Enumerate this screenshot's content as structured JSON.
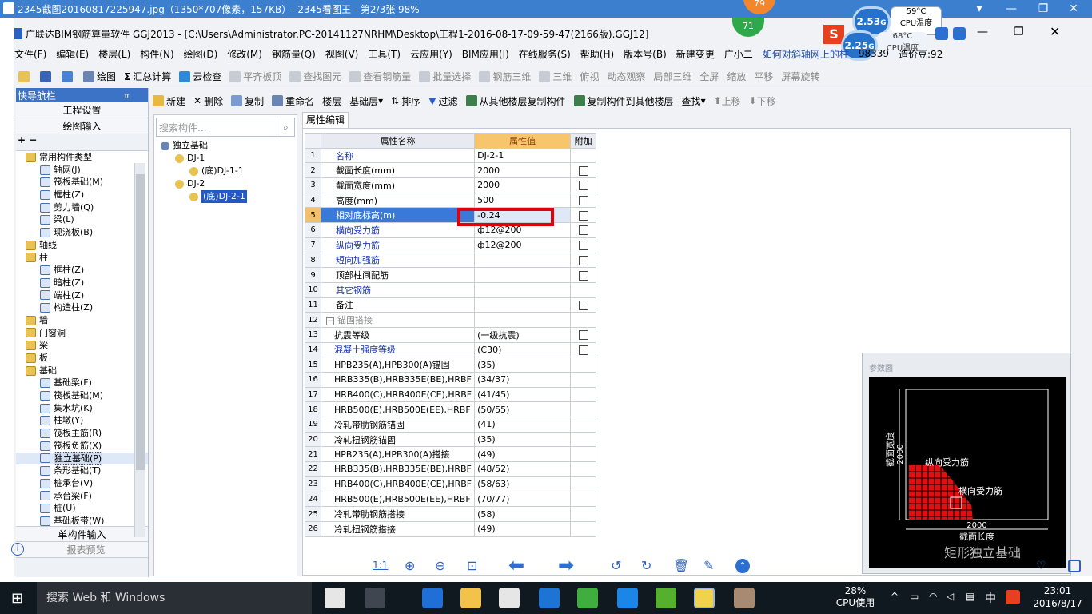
{
  "viewer": {
    "title": "2345截图20160817225947.jpg（1350*707像素，157KB）- 2345看图王 - 第2/3张 98%",
    "cpu_badge": "79",
    "controls": [
      "▾",
      "—",
      "❐",
      "✕"
    ]
  },
  "app": {
    "title": "广联达BIM钢筋算量软件 GGJ2013 - [C:\\Users\\Administrator.PC-20141127NRHM\\Desktop\\工程1-2016-08-17-09-59-47(2166版).GGJ12]",
    "badge": "71",
    "cpu_widget": {
      "g1": "2.53",
      "g2": "2.25",
      "temp1": "59°C",
      "temp2": "68°C",
      "label": "CPU温度",
      "unit": "G"
    },
    "menus": [
      "文件(F)",
      "编辑(E)",
      "楼层(L)",
      "构件(N)",
      "绘图(D)",
      "修改(M)",
      "钢筋量(Q)",
      "视图(V)",
      "工具(T)",
      "云应用(Y)",
      "BIM应用(I)",
      "在线服务(S)",
      "帮助(H)",
      "版本号(B)",
      "新建变更",
      "广小二"
    ],
    "help_link": "如何对斜轴网上的柱",
    "account": "98339",
    "price": "造价豆:92",
    "toolbar1": [
      "绘图",
      "汇总计算",
      "云检查",
      "平齐板顶",
      "查找图元",
      "查看钢筋量",
      "批量选择",
      "钢筋三维",
      "三维",
      "俯视",
      "动态观察",
      "局部三维",
      "全屏",
      "缩放",
      "平移",
      "屏幕旋转"
    ],
    "toolbar2": [
      "新建",
      "删除",
      "复制",
      "重命名",
      "楼层",
      "基础层",
      "排序",
      "过滤",
      "从其他楼层复制构件",
      "复制构件到其他楼层",
      "查找",
      "上移",
      "下移"
    ],
    "toolbar2_prefix": "Σ"
  },
  "nav": {
    "header": "快导航栏",
    "pin": "ㅍ",
    "btn1": "工程设置",
    "btn2": "绘图输入",
    "tree": [
      {
        "label": "常用构件类型",
        "indent": 1,
        "type": "folder"
      },
      {
        "label": "轴网(J)",
        "indent": 2,
        "type": "c"
      },
      {
        "label": "筏板基础(M)",
        "indent": 2,
        "type": "c"
      },
      {
        "label": "框柱(Z)",
        "indent": 2,
        "type": "c"
      },
      {
        "label": "剪力墙(Q)",
        "indent": 2,
        "type": "c"
      },
      {
        "label": "梁(L)",
        "indent": 2,
        "type": "c"
      },
      {
        "label": "现浇板(B)",
        "indent": 2,
        "type": "c"
      },
      {
        "label": "轴线",
        "indent": 1,
        "type": "folder"
      },
      {
        "label": "柱",
        "indent": 1,
        "type": "folder"
      },
      {
        "label": "框柱(Z)",
        "indent": 2,
        "type": "c"
      },
      {
        "label": "暗柱(Z)",
        "indent": 2,
        "type": "c"
      },
      {
        "label": "端柱(Z)",
        "indent": 2,
        "type": "c"
      },
      {
        "label": "构造柱(Z)",
        "indent": 2,
        "type": "c"
      },
      {
        "label": "墙",
        "indent": 1,
        "type": "folder"
      },
      {
        "label": "门窗洞",
        "indent": 1,
        "type": "folder"
      },
      {
        "label": "梁",
        "indent": 1,
        "type": "folder"
      },
      {
        "label": "板",
        "indent": 1,
        "type": "folder"
      },
      {
        "label": "基础",
        "indent": 1,
        "type": "folder"
      },
      {
        "label": "基础梁(F)",
        "indent": 2,
        "type": "c"
      },
      {
        "label": "筏板基础(M)",
        "indent": 2,
        "type": "c"
      },
      {
        "label": "集水坑(K)",
        "indent": 2,
        "type": "c"
      },
      {
        "label": "柱墩(Y)",
        "indent": 2,
        "type": "c"
      },
      {
        "label": "筏板主筋(R)",
        "indent": 2,
        "type": "c"
      },
      {
        "label": "筏板负筋(X)",
        "indent": 2,
        "type": "c"
      },
      {
        "label": "独立基础(P)",
        "indent": 2,
        "type": "c",
        "selected": true
      },
      {
        "label": "条形基础(T)",
        "indent": 2,
        "type": "c"
      },
      {
        "label": "桩承台(V)",
        "indent": 2,
        "type": "c"
      },
      {
        "label": "承台梁(F)",
        "indent": 2,
        "type": "c"
      },
      {
        "label": "桩(U)",
        "indent": 2,
        "type": "c"
      },
      {
        "label": "基础板带(W)",
        "indent": 2,
        "type": "c"
      }
    ],
    "btn3": "单构件输入",
    "btn4": "报表预览"
  },
  "components": {
    "search_placeholder": "搜索构件...",
    "items": [
      {
        "label": "独立基础",
        "indent": 0
      },
      {
        "label": "DJ-1",
        "indent": 1
      },
      {
        "label": "(底)DJ-1-1",
        "indent": 2
      },
      {
        "label": "DJ-2",
        "indent": 1
      },
      {
        "label": "(底)DJ-2-1",
        "indent": 2,
        "selected": true
      }
    ]
  },
  "props": {
    "tab": "属性编辑",
    "headers": [
      "属性名称",
      "属性值",
      "附加"
    ],
    "rows": [
      {
        "n": "1",
        "name": "名称",
        "value": "DJ-2-1",
        "blue": true,
        "chk": false
      },
      {
        "n": "2",
        "name": "截面长度(mm)",
        "value": "2000",
        "blue": false,
        "chk": true
      },
      {
        "n": "3",
        "name": "截面宽度(mm)",
        "value": "2000",
        "blue": false,
        "chk": true
      },
      {
        "n": "4",
        "name": "高度(mm)",
        "value": "500",
        "blue": false,
        "chk": true
      },
      {
        "n": "5",
        "name": "相对底标高(m)",
        "value": "-0.24",
        "blue": false,
        "chk": true,
        "sel": true
      },
      {
        "n": "6",
        "name": "横向受力筋",
        "value": "ф12@200",
        "blue": true,
        "chk": true
      },
      {
        "n": "7",
        "name": "纵向受力筋",
        "value": "ф12@200",
        "blue": true,
        "chk": true
      },
      {
        "n": "8",
        "name": "短向加强筋",
        "value": "",
        "blue": true,
        "chk": true
      },
      {
        "n": "9",
        "name": "顶部柱间配筋",
        "value": "",
        "blue": false,
        "chk": true
      },
      {
        "n": "10",
        "name": "其它钢筋",
        "value": "",
        "blue": true,
        "chk": false
      },
      {
        "n": "11",
        "name": "备注",
        "value": "",
        "blue": false,
        "chk": true
      },
      {
        "n": "12",
        "name": "锚固搭接",
        "value": "",
        "blue": false,
        "chk": false,
        "group": true
      },
      {
        "n": "13",
        "name": "抗震等级",
        "value": "(一级抗震)",
        "blue": false,
        "chk": true,
        "sub": true
      },
      {
        "n": "14",
        "name": "混凝土强度等级",
        "value": "(C30)",
        "blue": true,
        "chk": true,
        "sub": true
      },
      {
        "n": "15",
        "name": "HPB235(A),HPB300(A)锚固",
        "value": "(35)",
        "blue": false,
        "chk": false,
        "sub": true
      },
      {
        "n": "16",
        "name": "HRB335(B),HRB335E(BE),HRBF",
        "value": "(34/37)",
        "blue": false,
        "chk": false,
        "sub": true
      },
      {
        "n": "17",
        "name": "HRB400(C),HRB400E(CE),HRBF",
        "value": "(41/45)",
        "blue": false,
        "chk": false,
        "sub": true
      },
      {
        "n": "18",
        "name": "HRB500(E),HRB500E(EE),HRBF",
        "value": "(50/55)",
        "blue": false,
        "chk": false,
        "sub": true
      },
      {
        "n": "19",
        "name": "冷轧带肋钢筋锚固",
        "value": "(41)",
        "blue": false,
        "chk": false,
        "sub": true
      },
      {
        "n": "20",
        "name": "冷轧扭钢筋锚固",
        "value": "(35)",
        "blue": false,
        "chk": false,
        "sub": true
      },
      {
        "n": "21",
        "name": "HPB235(A),HPB300(A)搭接",
        "value": "(49)",
        "blue": false,
        "chk": false,
        "sub": true
      },
      {
        "n": "22",
        "name": "HRB335(B),HRB335E(BE),HRBF",
        "value": "(48/52)",
        "blue": false,
        "chk": false,
        "sub": true
      },
      {
        "n": "23",
        "name": "HRB400(C),HRB400E(CE),HRBF",
        "value": "(58/63)",
        "blue": false,
        "chk": false,
        "sub": true
      },
      {
        "n": "24",
        "name": "HRB500(E),HRB500E(EE),HRBF",
        "value": "(70/77)",
        "blue": false,
        "chk": false,
        "sub": true
      },
      {
        "n": "25",
        "name": "冷轧带肋钢筋搭接",
        "value": "(58)",
        "blue": false,
        "chk": false,
        "sub": true
      },
      {
        "n": "26",
        "name": "冷轧扭钢筋搭接",
        "value": "(49)",
        "blue": false,
        "chk": false,
        "sub": true
      }
    ]
  },
  "diagram": {
    "title": "参数图",
    "width_label": "截面宽度",
    "width_value": "2000",
    "length_label": "截面长度",
    "length_value": "2000",
    "long_rebar": "纵向受力筋",
    "trans_rebar": "横向受力筋",
    "footer": "矩形独立基础"
  },
  "bottombar": {
    "zoom_label": "1:1"
  },
  "taskbar": {
    "search": "搜索 Web 和 Windows",
    "cpu_pct": "28%",
    "cpu_label": "CPU使用",
    "ime": "中",
    "time": "23:01",
    "date": "2016/8/17"
  },
  "colors": {
    "accent": "#3c7fcf",
    "selection": "#3b79d8",
    "highlight": "#e0000f",
    "header_value": "#f6c56c"
  }
}
